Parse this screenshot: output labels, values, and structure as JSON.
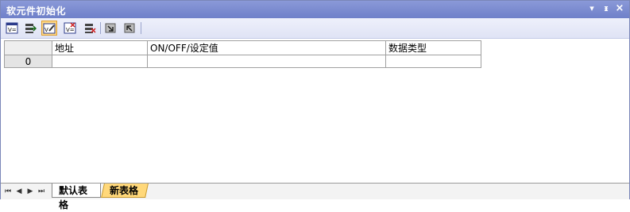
{
  "window": {
    "title": "软元件初始化",
    "controls": {
      "dropdown": "▾",
      "pin": "ᵻ",
      "close": "×"
    }
  },
  "toolbar": {
    "icons": [
      "device-list-icon",
      "insert-row-icon",
      "edit-mode-icon",
      "delete-row-icon",
      "clear-icon",
      "import-icon",
      "export-icon"
    ],
    "active_index": 2
  },
  "grid": {
    "columns": [
      "地址",
      "ON/OFF/设定值",
      "数据类型"
    ],
    "rows": [
      {
        "index": "0",
        "address": "",
        "value": "",
        "type": ""
      }
    ]
  },
  "sheet_nav": {
    "first": "⏮",
    "prev": "◀",
    "next": "▶",
    "last": "⏭"
  },
  "sheets": [
    {
      "label": "默认表格",
      "active": false
    },
    {
      "label": "新表格",
      "active": true
    }
  ]
}
